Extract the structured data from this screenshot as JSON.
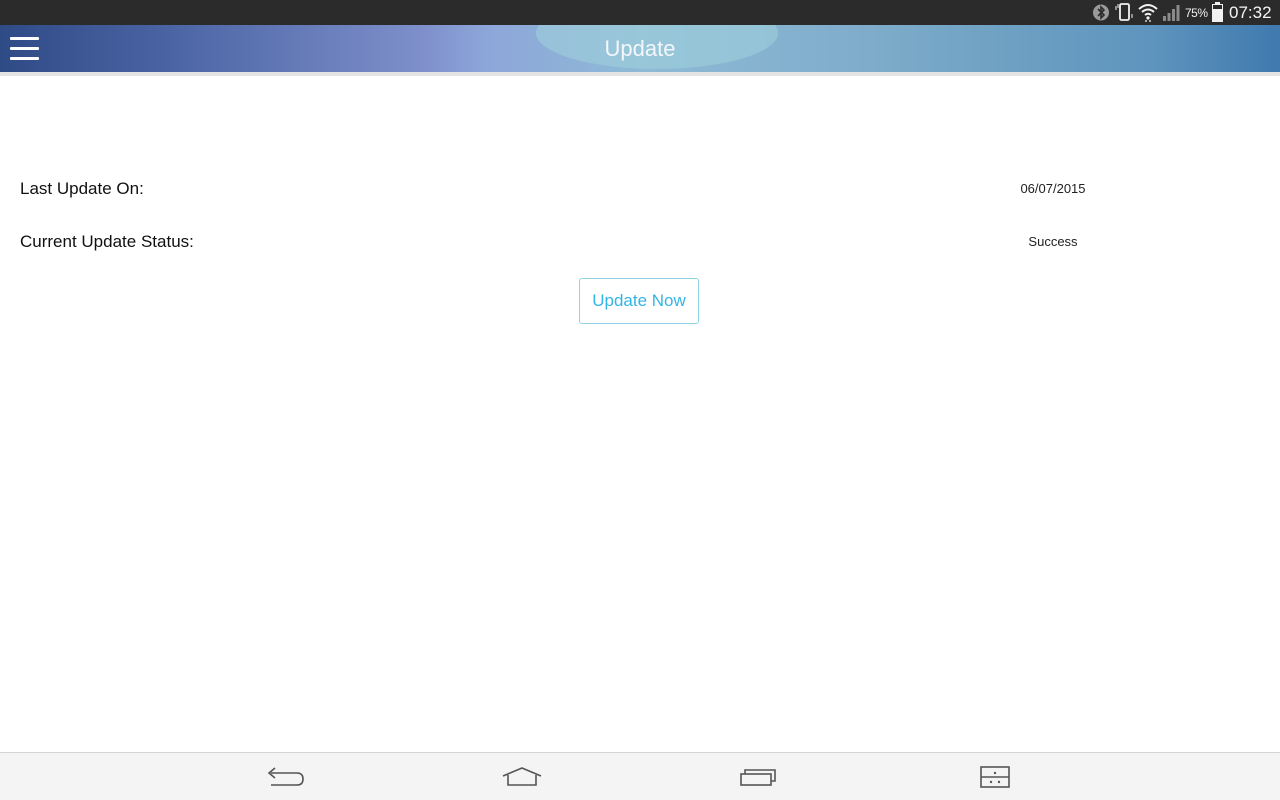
{
  "status_bar": {
    "battery_percent": "75%",
    "time": "07:32",
    "icons": [
      "bluetooth-icon",
      "vibrate-icon",
      "wifi-icon",
      "signal-icon",
      "battery-icon"
    ]
  },
  "header": {
    "title": "Update",
    "menu_icon": "hamburger-menu-icon"
  },
  "content": {
    "last_update_label": "Last Update On:",
    "last_update_value": "06/07/2015",
    "status_label": "Current Update Status:",
    "status_value": "Success",
    "update_button_label": "Update Now"
  },
  "nav_bar": {
    "icons": [
      "back-icon",
      "home-icon",
      "recent-apps-icon",
      "dual-window-icon"
    ]
  },
  "colors": {
    "accent": "#33b5e5",
    "header_start": "#2f4b86",
    "header_end": "#3f79ae",
    "status_bar": "#2b2b2b"
  }
}
